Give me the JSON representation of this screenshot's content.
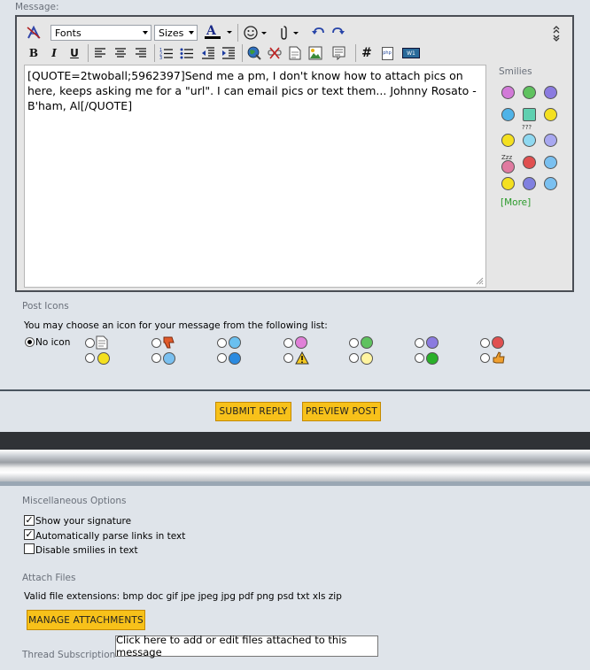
{
  "message_label": "Message:",
  "toolbar": {
    "font_select": "Fonts",
    "size_select": "Sizes",
    "bold": "B",
    "italic": "I",
    "underline": "U",
    "hash": "#",
    "php": "php",
    "wrap": "W1"
  },
  "editor": {
    "text": "[QUOTE=2twoball;5962397]Send me a pm, I don't know how to attach pics on here, keeps asking me for a \"url\". I can email pics or text them... Johnny Rosato - B'ham, Al[/QUOTE]"
  },
  "smilies": {
    "title": "Smilies",
    "more": "[More]",
    "zzz": "Zzz",
    "qqq": "???"
  },
  "post_icons": {
    "title": "Post Icons",
    "instructions": "You may choose an icon for your message from the following list:",
    "no_icon_label": "No icon"
  },
  "actions": {
    "submit": "SUBMIT REPLY",
    "preview": "PREVIEW POST"
  },
  "misc": {
    "title": "Miscellaneous Options",
    "show_signature": "Show your signature",
    "parse_links": "Automatically parse links in text",
    "disable_smilies": "Disable smilies in text"
  },
  "attach": {
    "title": "Attach Files",
    "valid_ext": "Valid file extensions: bmp doc gif jpe jpeg jpg pdf png psd txt xls zip",
    "manage_button": "MANAGE ATTACHMENTS",
    "tooltip": "Click here to add or edit files attached to this message"
  },
  "thread_sub": {
    "title": "Thread Subscription"
  }
}
